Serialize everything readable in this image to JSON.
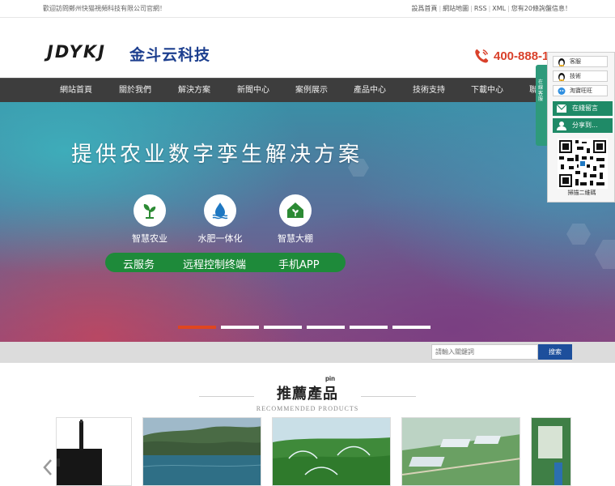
{
  "topbar": {
    "welcome": "歡迎訪問鄭州快猫視頻科技有限公司官網！",
    "links": [
      "設爲首頁",
      "網站地圖",
      "RSS",
      "XML",
      "您有20條詢盤信息！"
    ]
  },
  "header": {
    "logo_latin": "JDYKJ",
    "logo_cn": "金斗云科技",
    "phone": "400-888-1"
  },
  "nav": {
    "items": [
      "網站首頁",
      "關於我們",
      "解決方案",
      "新聞中心",
      "案例展示",
      "產品中心",
      "技術支持",
      "下載中心",
      "聯"
    ]
  },
  "banner": {
    "headline": "提供农业数字孪生解决方案",
    "features": [
      {
        "label": "智慧农业",
        "icon": "plant-icon"
      },
      {
        "label": "水肥一体化",
        "icon": "water-drop-icon"
      },
      {
        "label": "智慧大棚",
        "icon": "greenhouse-icon"
      }
    ],
    "pill": [
      "云服务",
      "远程控制终端",
      "手机APP"
    ],
    "slide_count": 6,
    "active_slide": 0
  },
  "search": {
    "placeholder": "請輸入關鍵詞",
    "button": "搜索"
  },
  "recommend": {
    "title": "推薦產品",
    "pinyin": "pin",
    "subtitle": "RECOMMENDED PRODUCTS"
  },
  "side_panel": {
    "tab_label": "在線客服",
    "qq_items": [
      "客服",
      "技術",
      "淘寶旺旺"
    ],
    "message_btn": "在綫留言",
    "share_btn": "分享到...",
    "qr_caption": "掃描二維碼"
  },
  "colors": {
    "nav_bg": "#3d3d3d",
    "accent_red": "#e0461f",
    "phone_red": "#d9412b",
    "green": "#1e8a3a",
    "search_blue": "#1d4f9c",
    "side_green": "#1f8a67"
  }
}
